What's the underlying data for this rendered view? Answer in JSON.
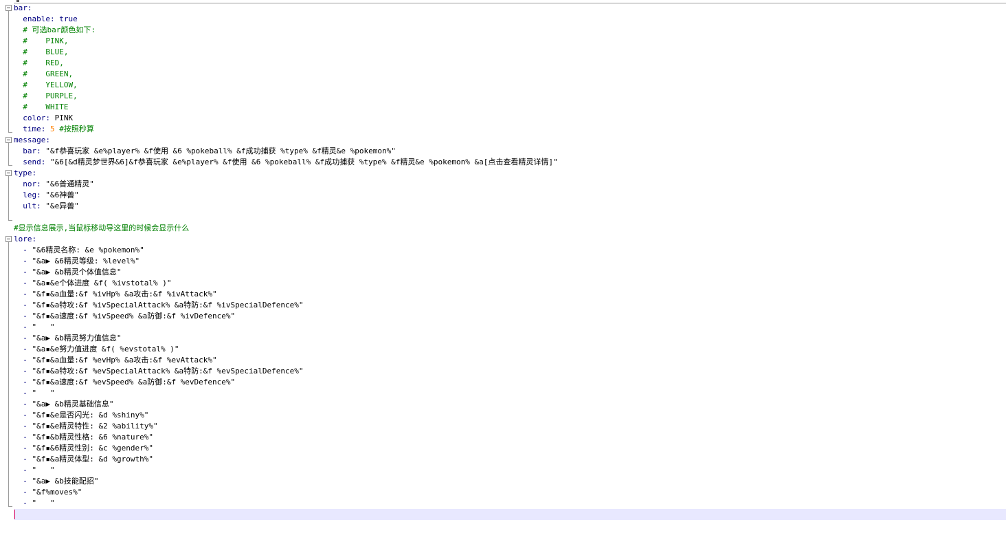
{
  "editor": {
    "lines": [
      [
        {
          "t": "bar:",
          "c": "key"
        }
      ],
      [
        {
          "t": "  enable: ",
          "c": "key"
        },
        {
          "t": "true",
          "c": "bool"
        }
      ],
      [
        {
          "t": "  # 可选bar颜色如下:",
          "c": "comment"
        }
      ],
      [
        {
          "t": "  #    PINK,",
          "c": "comment"
        }
      ],
      [
        {
          "t": "  #    BLUE,",
          "c": "comment"
        }
      ],
      [
        {
          "t": "  #    RED,",
          "c": "comment"
        }
      ],
      [
        {
          "t": "  #    GREEN,",
          "c": "comment"
        }
      ],
      [
        {
          "t": "  #    YELLOW,",
          "c": "comment"
        }
      ],
      [
        {
          "t": "  #    PURPLE,",
          "c": "comment"
        }
      ],
      [
        {
          "t": "  #    WHITE",
          "c": "comment"
        }
      ],
      [
        {
          "t": "  color: ",
          "c": "key"
        },
        {
          "t": "PINK",
          "c": "plain"
        }
      ],
      [
        {
          "t": "  time: ",
          "c": "key"
        },
        {
          "t": "5",
          "c": "num"
        },
        {
          "t": " #按照秒算",
          "c": "comment"
        }
      ],
      [
        {
          "t": "message:",
          "c": "key"
        }
      ],
      [
        {
          "t": "  bar: ",
          "c": "key"
        },
        {
          "t": "\"&f恭喜玩家 &e%player% &f使用 &6 %pokeball% &f成功捕获 %type% &f精灵&e %pokemon%\"",
          "c": "str"
        }
      ],
      [
        {
          "t": "  send: ",
          "c": "key"
        },
        {
          "t": "\"&6[&d精灵梦世界&6]&f恭喜玩家 &e%player% &f使用 &6 %pokeball% &f成功捕获 %type% &f精灵&e %pokemon% &a[点击查看精灵详情]\"",
          "c": "str"
        }
      ],
      [
        {
          "t": "type:",
          "c": "key"
        }
      ],
      [
        {
          "t": "  nor: ",
          "c": "key"
        },
        {
          "t": "\"&6普通精灵\"",
          "c": "str"
        }
      ],
      [
        {
          "t": "  leg: ",
          "c": "key"
        },
        {
          "t": "\"&6神兽\"",
          "c": "str"
        }
      ],
      [
        {
          "t": "  ult: ",
          "c": "key"
        },
        {
          "t": "\"&e异兽\"",
          "c": "str"
        }
      ],
      [
        {
          "t": "",
          "c": "plain"
        }
      ],
      [
        {
          "t": "#显示信息展示,当鼠标移动导这里的时候会显示什么",
          "c": "comment"
        }
      ],
      [
        {
          "t": "lore:",
          "c": "key"
        }
      ],
      [
        {
          "t": "  - ",
          "c": "punct"
        },
        {
          "t": "\"&6精灵名称: &e %pokemon%\"",
          "c": "str"
        }
      ],
      [
        {
          "t": "  - ",
          "c": "punct"
        },
        {
          "t": "\"&a▶ &6精灵等级: %level%\"",
          "c": "str"
        }
      ],
      [
        {
          "t": "  - ",
          "c": "punct"
        },
        {
          "t": "\"&a▶ &b精灵个体值信息\"",
          "c": "str"
        }
      ],
      [
        {
          "t": "  - ",
          "c": "punct"
        },
        {
          "t": "\"&a▪&e个体进度 &f( %ivstotal% )\"",
          "c": "str"
        }
      ],
      [
        {
          "t": "  - ",
          "c": "punct"
        },
        {
          "t": "\"&f▪&a血量:&f %ivHp% &a攻击:&f %ivAttack%\"",
          "c": "str"
        }
      ],
      [
        {
          "t": "  - ",
          "c": "punct"
        },
        {
          "t": "\"&f▪&a特攻:&f %ivSpecialAttack% &a特防:&f %ivSpecialDefence%\"",
          "c": "str"
        }
      ],
      [
        {
          "t": "  - ",
          "c": "punct"
        },
        {
          "t": "\"&f▪&a速度:&f %ivSpeed% &a防御:&f %ivDefence%\"",
          "c": "str"
        }
      ],
      [
        {
          "t": "  - ",
          "c": "punct"
        },
        {
          "t": "\"   \"",
          "c": "str"
        }
      ],
      [
        {
          "t": "  - ",
          "c": "punct"
        },
        {
          "t": "\"&a▶ &b精灵努力值信息\"",
          "c": "str"
        }
      ],
      [
        {
          "t": "  - ",
          "c": "punct"
        },
        {
          "t": "\"&a▪&e努力值进度 &f( %evstotal% )\"",
          "c": "str"
        }
      ],
      [
        {
          "t": "  - ",
          "c": "punct"
        },
        {
          "t": "\"&f▪&a血量:&f %evHp% &a攻击:&f %evAttack%\"",
          "c": "str"
        }
      ],
      [
        {
          "t": "  - ",
          "c": "punct"
        },
        {
          "t": "\"&f▪&a特攻:&f %evSpecialAttack% &a特防:&f %evSpecialDefence%\"",
          "c": "str"
        }
      ],
      [
        {
          "t": "  - ",
          "c": "punct"
        },
        {
          "t": "\"&f▪&a速度:&f %evSpeed% &a防御:&f %evDefence%\"",
          "c": "str"
        }
      ],
      [
        {
          "t": "  - ",
          "c": "punct"
        },
        {
          "t": "\"   \"",
          "c": "str"
        }
      ],
      [
        {
          "t": "  - ",
          "c": "punct"
        },
        {
          "t": "\"&a▶ &b精灵基础信息\"",
          "c": "str"
        }
      ],
      [
        {
          "t": "  - ",
          "c": "punct"
        },
        {
          "t": "\"&f▪&e是否闪光: &d %shiny%\"",
          "c": "str"
        }
      ],
      [
        {
          "t": "  - ",
          "c": "punct"
        },
        {
          "t": "\"&f▪&e精灵特性: &2 %ability%\"",
          "c": "str"
        }
      ],
      [
        {
          "t": "  - ",
          "c": "punct"
        },
        {
          "t": "\"&f▪&b精灵性格: &6 %nature%\"",
          "c": "str"
        }
      ],
      [
        {
          "t": "  - ",
          "c": "punct"
        },
        {
          "t": "\"&f▪&6精灵性别: &c %gender%\"",
          "c": "str"
        }
      ],
      [
        {
          "t": "  - ",
          "c": "punct"
        },
        {
          "t": "\"&f▪&a精灵体型: &d %growth%\"",
          "c": "str"
        }
      ],
      [
        {
          "t": "  - ",
          "c": "punct"
        },
        {
          "t": "\"   \"",
          "c": "str"
        }
      ],
      [
        {
          "t": "  - ",
          "c": "punct"
        },
        {
          "t": "\"&a▶ &b技能配招\"",
          "c": "str"
        }
      ],
      [
        {
          "t": "  - ",
          "c": "punct"
        },
        {
          "t": "\"&f%moves%\"",
          "c": "str"
        }
      ],
      [
        {
          "t": "  - ",
          "c": "punct"
        },
        {
          "t": "\"   \"",
          "c": "str"
        }
      ],
      [
        {
          "t": "",
          "c": "plain"
        }
      ]
    ],
    "current_line": 46,
    "folds": [
      {
        "start": 0,
        "end": 11
      },
      {
        "start": 12,
        "end": 14
      },
      {
        "start": 15,
        "end": 19
      },
      {
        "start": 21,
        "end": 45
      }
    ]
  }
}
